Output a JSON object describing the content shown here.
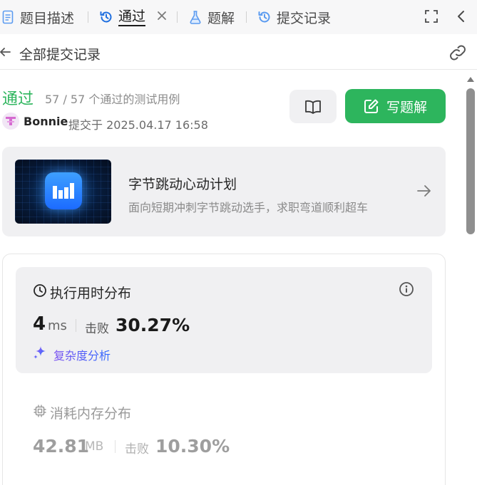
{
  "tabs": {
    "description": "题目描述",
    "accepted": "通过",
    "solutions": "题解",
    "submissions": "提交记录"
  },
  "subheader": {
    "title": "全部提交记录"
  },
  "result": {
    "status": "通过",
    "cases": "57 / 57 个通过的测试用例",
    "author": "Bonnie",
    "submitted": "提交于 2025.04.17 16:58",
    "write_solution": "写题解"
  },
  "promo": {
    "title": "字节跳动心动计划",
    "subtitle": "面向短期冲刺字节跳动选手，求职弯道顺利超车"
  },
  "runtime": {
    "title": "执行用时分布",
    "value": "4",
    "unit": "ms",
    "beat_label": "击败",
    "beat_pct": "30.27%",
    "complexity_link": "复杂度分析"
  },
  "memory": {
    "title": "消耗内存分布",
    "value": "42.81",
    "unit": "MB",
    "beat_label": "击败",
    "beat_pct": "10.30%"
  },
  "colors": {
    "accent_green": "#2db55d",
    "tab_bar_bg": "#f7f7f8",
    "card_bg": "#f0f0f2"
  },
  "icons": {
    "description": "document-icon",
    "accepted": "history-icon",
    "solutions": "flask-icon",
    "submissions": "history-icon",
    "close": "close-icon",
    "fullscreen": "fullscreen-icon",
    "collapse": "chevron-left-icon",
    "back": "arrow-left-icon",
    "link": "link-icon",
    "book": "book-icon",
    "edit": "edit-icon",
    "arrow": "arrow-right-icon",
    "clock": "clock-icon",
    "info": "info-icon",
    "sparkle": "sparkle-icon",
    "chip": "chip-icon"
  }
}
